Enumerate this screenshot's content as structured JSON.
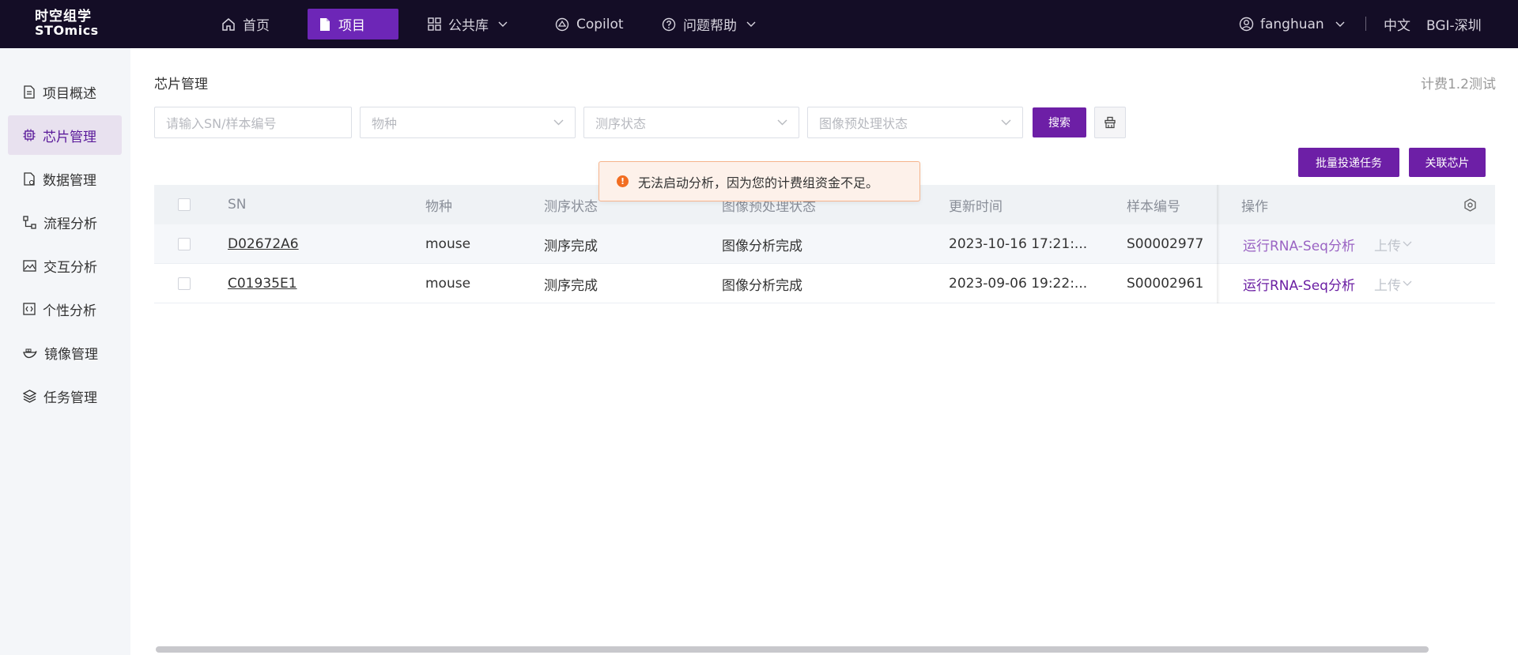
{
  "topbar": {
    "logo_cn": "时空组学",
    "logo_en": "STOmics",
    "nav": [
      {
        "label": "首页",
        "icon": "home-icon"
      },
      {
        "label": "项目",
        "icon": "document-icon",
        "active": true
      },
      {
        "label": "公共库",
        "icon": "grid-icon"
      },
      {
        "label": "Copilot",
        "icon": "copilot-icon"
      },
      {
        "label": "问题帮助",
        "icon": "help-icon"
      }
    ],
    "user": "fanghuan",
    "language": "中文",
    "org": "BGI-深圳"
  },
  "sidebar": {
    "items": [
      {
        "label": "项目概述",
        "icon": "overview-icon"
      },
      {
        "label": "芯片管理",
        "icon": "chip-icon",
        "active": true
      },
      {
        "label": "数据管理",
        "icon": "data-file-icon"
      },
      {
        "label": "流程分析",
        "icon": "flow-icon"
      },
      {
        "label": "交互分析",
        "icon": "image-icon"
      },
      {
        "label": "个性分析",
        "icon": "code-icon"
      },
      {
        "label": "镜像管理",
        "icon": "docker-icon"
      },
      {
        "label": "任务管理",
        "icon": "layers-icon"
      }
    ]
  },
  "main": {
    "title": "芯片管理",
    "billing_group": "计费1.2测试",
    "filters": {
      "sn_placeholder": "请输入SN/样本编号",
      "species_placeholder": "物种",
      "seq_status_placeholder": "测序状态",
      "image_status_placeholder": "图像预处理状态"
    },
    "search_button": "搜索",
    "batch_button": "批量投递任务",
    "link_chip_button": "关联芯片"
  },
  "toast": {
    "type": "warning",
    "message": "无法启动分析，因为您的计费组资金不足。"
  },
  "table": {
    "headers": {
      "sn": "SN",
      "species": "物种",
      "seq_status": "测序状态",
      "image_status": "图像预处理状态",
      "updated": "更新时间",
      "sample": "样本编号",
      "ops": "操作"
    },
    "rows": [
      {
        "sn": "D02672A6",
        "species": "mouse",
        "seq_status": "测序完成",
        "image_status": "图像分析完成",
        "updated": "2023-10-16 17:21:...",
        "sample": "S00002977",
        "action": "运行RNA-Seq分析",
        "upload": "上传"
      },
      {
        "sn": "C01935E1",
        "species": "mouse",
        "seq_status": "测序完成",
        "image_status": "图像分析完成",
        "updated": "2023-09-06 19:22:...",
        "sample": "S00002961",
        "action": "运行RNA-Seq分析",
        "upload": "上传"
      }
    ]
  },
  "colors": {
    "topbar_bg": "#140d26",
    "accent": "#6d1fa6",
    "warning": "#f26d21"
  }
}
